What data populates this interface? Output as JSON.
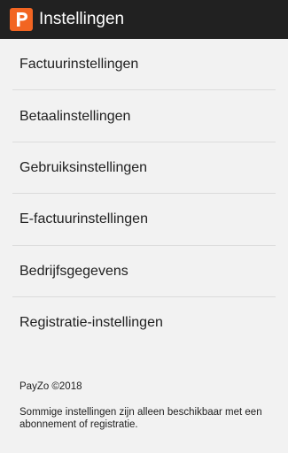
{
  "header": {
    "title": "Instellingen",
    "logo_icon": "payzo-logo-icon",
    "logo_color": "#f26522"
  },
  "menu": {
    "items": [
      {
        "label": "Factuurinstellingen"
      },
      {
        "label": "Betaalinstellingen"
      },
      {
        "label": "Gebruiksinstellingen"
      },
      {
        "label": "E-factuurinstellingen"
      },
      {
        "label": "Bedrijfsgegevens"
      },
      {
        "label": "Registratie-instellingen"
      }
    ]
  },
  "footer": {
    "copyright": "PayZo ©2018",
    "note": "Sommige instellingen zijn alleen beschikbaar met een abonnement of registratie."
  },
  "colors": {
    "toolbar": "#212121",
    "background": "#f2f2f2",
    "divider": "#dcdcdc",
    "text": "#212121"
  }
}
